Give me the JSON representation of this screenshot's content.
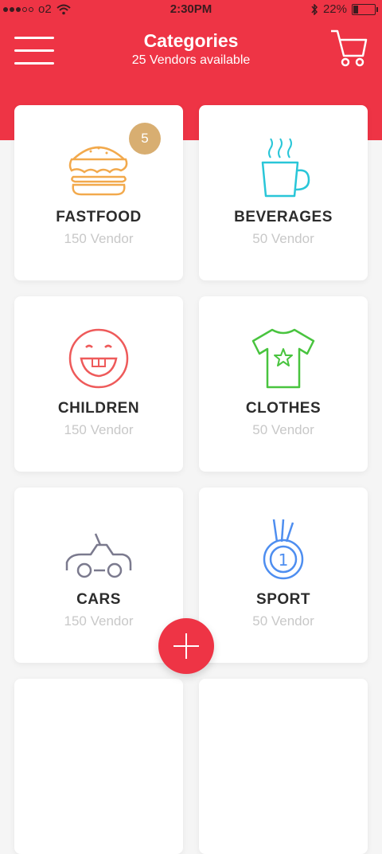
{
  "status": {
    "carrier": "o2",
    "time": "2:30PM",
    "battery": "22%"
  },
  "header": {
    "title": "Categories",
    "subtitle": "25 Vendors available"
  },
  "colors": {
    "brand": "#ee3445",
    "badge": "#d8ae71"
  },
  "categories": [
    {
      "name": "FASTFOOD",
      "count": "150 Vendor",
      "icon": "burger-icon",
      "badge": "5"
    },
    {
      "name": "BEVERAGES",
      "count": "50 Vendor",
      "icon": "coffee-cup-icon"
    },
    {
      "name": "CHILDREN",
      "count": "150 Vendor",
      "icon": "smiley-face-icon"
    },
    {
      "name": "CLOTHES",
      "count": "50 Vendor",
      "icon": "tshirt-icon"
    },
    {
      "name": "CARS",
      "count": "150 Vendor",
      "icon": "car-icon"
    },
    {
      "name": "SPORT",
      "count": "50 Vendor",
      "icon": "medal-icon"
    }
  ]
}
